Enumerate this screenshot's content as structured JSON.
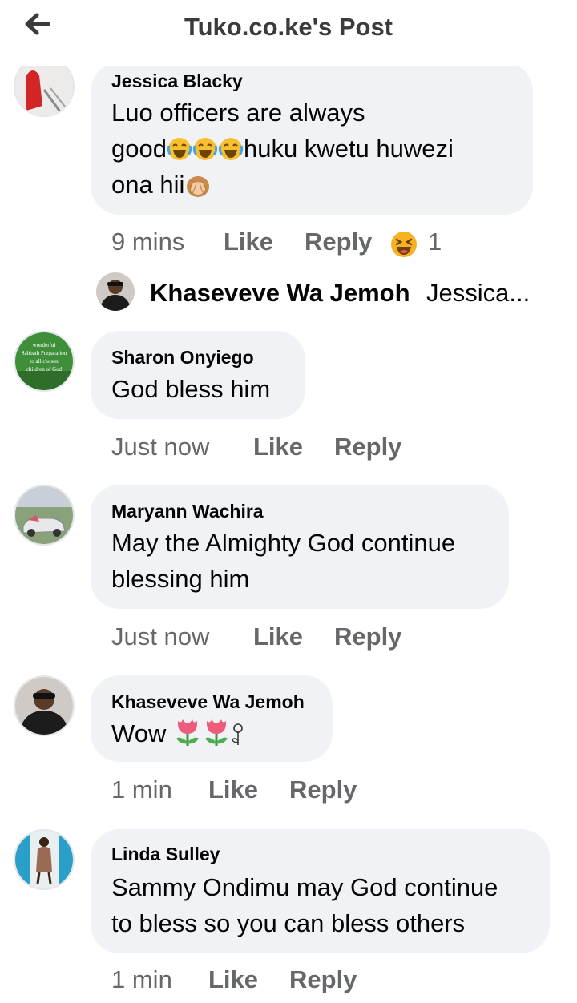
{
  "header": {
    "title": "Tuko.co.ke's Post"
  },
  "comments": [
    {
      "author": "Jessica Blacky",
      "lines": [
        "Luo officers are always",
        "good",
        "huku kwetu huwezi",
        "ona hii"
      ],
      "time": "9 mins",
      "like": "Like",
      "reply": "Reply",
      "reaction_count": "1"
    },
    {
      "author": "Sharon Onyiego",
      "lines": [
        "God bless him"
      ],
      "time": "Just now",
      "like": "Like",
      "reply": "Reply",
      "avatar_text": [
        "wonderful",
        "Sabbath Preparation",
        "to all chosen",
        "children of God"
      ]
    },
    {
      "author": "Maryann Wachira",
      "lines": [
        "May the Almighty God continue",
        "blessing him"
      ],
      "time": "Just now",
      "like": "Like",
      "reply": "Reply"
    },
    {
      "author": "Khaseveve Wa Jemoh",
      "lines": [
        "Wow"
      ],
      "time": "1 min",
      "like": "Like",
      "reply": "Reply"
    },
    {
      "author": "Linda Sulley",
      "lines": [
        "Sammy Ondimu may God continue",
        "to bless so you can bless others"
      ],
      "time": "1 min",
      "like": "Like",
      "reply": "Reply"
    }
  ],
  "reply_preview": {
    "author": "Khaseveve Wa Jemoh",
    "snippet": "Jessica..."
  },
  "icons": {
    "back": "arrow-left-icon",
    "laugh": "laughing-crying-emoji",
    "see_no_evil": "hands-over-eyes-emoji",
    "haha_reaction": "haha-reaction-icon",
    "tulip": "tulip-emoji",
    "flower": "small-flower-emoji"
  },
  "colors": {
    "bubble": "#f0f2f5",
    "meta": "#65676b",
    "text": "#050505",
    "haha": "#f7b125"
  }
}
